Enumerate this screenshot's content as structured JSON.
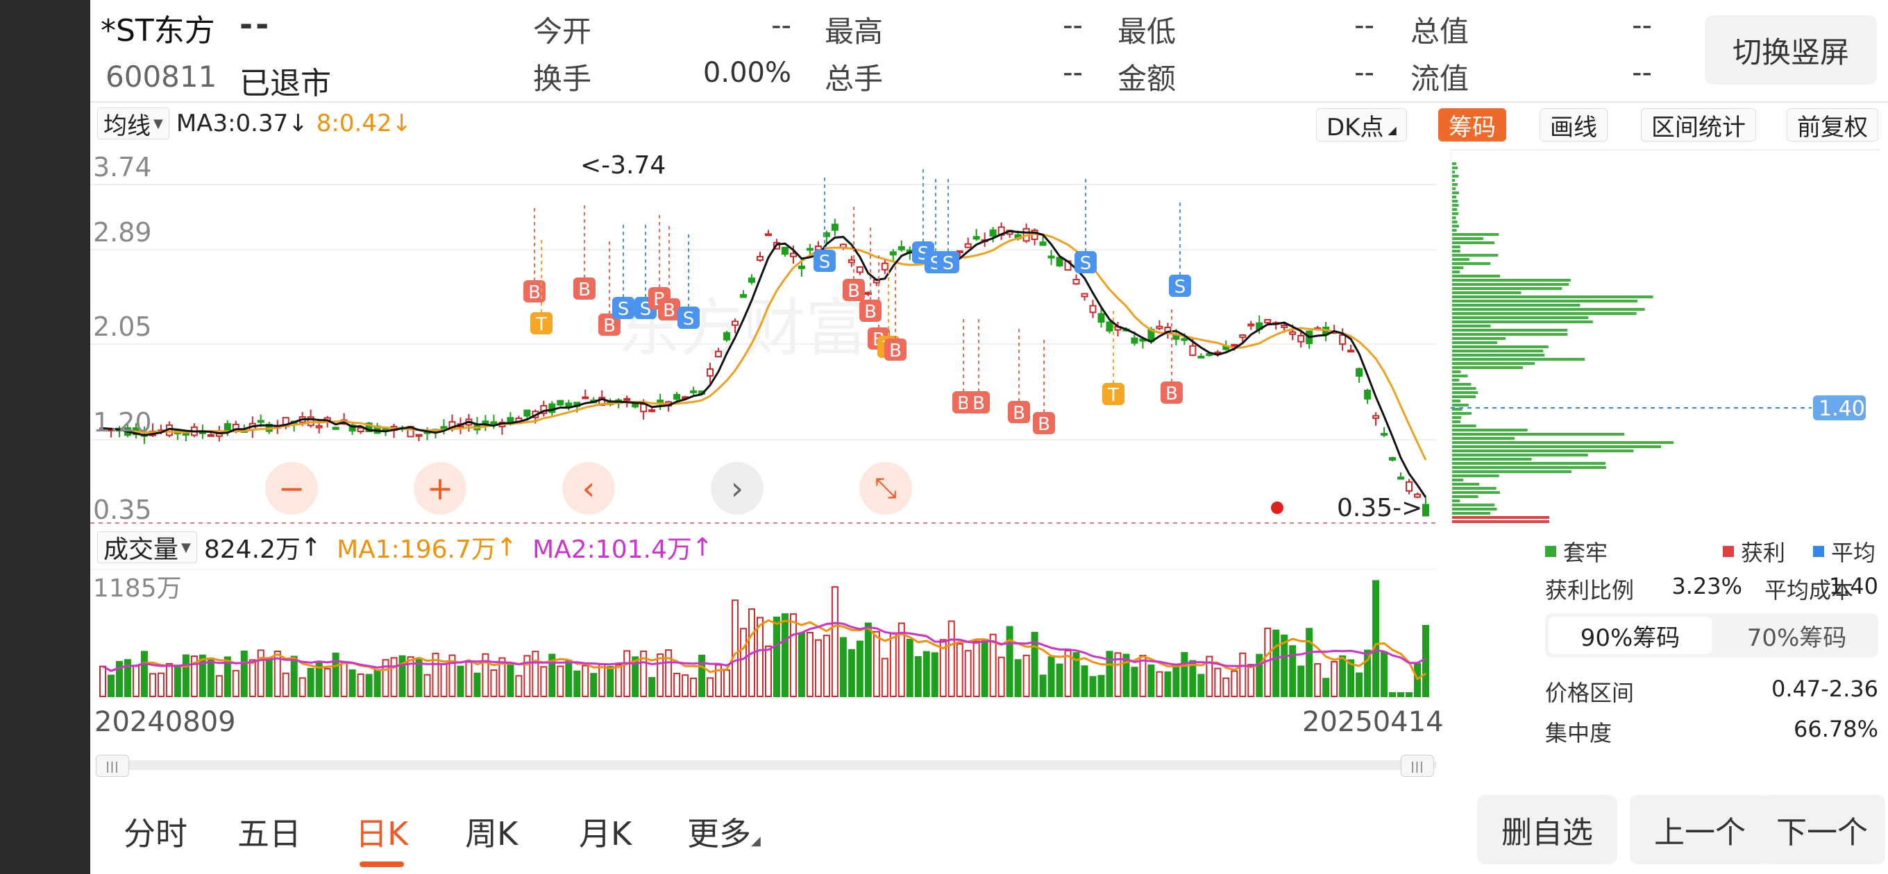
{
  "header": {
    "name": "*ST东方",
    "price": "--",
    "code": "600811",
    "status": "已退市",
    "switch_button": "切换竖屏",
    "quotes": [
      {
        "label": "今开",
        "value": "--"
      },
      {
        "label": "最高",
        "value": "--"
      },
      {
        "label": "最低",
        "value": "--"
      },
      {
        "label": "总值",
        "value": "--"
      },
      {
        "label": "换手",
        "value": "0.00%"
      },
      {
        "label": "总手",
        "value": "--"
      },
      {
        "label": "金额",
        "value": "--"
      },
      {
        "label": "流值",
        "value": "--"
      }
    ]
  },
  "ma_bar": {
    "selector": "均线",
    "ma3": "MA3:0.37",
    "ma3_arrow": "↓",
    "ma8": "8:0.42",
    "ma8_arrow": "↓",
    "colors": {
      "ma3": "#222222",
      "ma8": "#f0910a"
    }
  },
  "toolbar": {
    "dk": "DK点",
    "chips": "筹码",
    "draw": "画线",
    "range": "区间统计",
    "adjust": "前复权"
  },
  "price_chart": {
    "y_labels": [
      "3.74",
      "2.89",
      "2.05",
      "1.20",
      "0.35"
    ],
    "high_annotation": "<-3.74",
    "low_annotation": "0.35->",
    "avg_cost_tag": "1.40",
    "colors": {
      "up": "#cc2a2a",
      "down": "#1ea01e",
      "ma_slow": "#f0a020",
      "ma_fast": "#111111"
    },
    "signals": [
      {
        "letter": "B",
        "kind": "buy"
      },
      {
        "letter": "T",
        "kind": "t"
      },
      {
        "letter": "B",
        "kind": "buy"
      },
      {
        "letter": "B",
        "kind": "buy"
      },
      {
        "letter": "S",
        "kind": "sell"
      },
      {
        "letter": "S",
        "kind": "sell"
      },
      {
        "letter": "B",
        "kind": "buy"
      },
      {
        "letter": "B",
        "kind": "buy"
      },
      {
        "letter": "S",
        "kind": "sell"
      },
      {
        "letter": "S",
        "kind": "sell"
      },
      {
        "letter": "B",
        "kind": "buy"
      },
      {
        "letter": "B",
        "kind": "buy"
      },
      {
        "letter": "B",
        "kind": "buy"
      },
      {
        "letter": "T",
        "kind": "t"
      },
      {
        "letter": "B",
        "kind": "buy"
      },
      {
        "letter": "S",
        "kind": "sell"
      },
      {
        "letter": "S",
        "kind": "sell"
      },
      {
        "letter": "S",
        "kind": "sell"
      },
      {
        "letter": "B",
        "kind": "buy"
      },
      {
        "letter": "B",
        "kind": "buy"
      },
      {
        "letter": "B",
        "kind": "buy"
      },
      {
        "letter": "B",
        "kind": "buy"
      },
      {
        "letter": "S",
        "kind": "sell"
      },
      {
        "letter": "T",
        "kind": "t"
      },
      {
        "letter": "B",
        "kind": "buy"
      },
      {
        "letter": "S",
        "kind": "sell"
      }
    ]
  },
  "volume": {
    "selector": "成交量",
    "current": "824.2万",
    "current_arrow": "↑",
    "ma1": "MA1:196.7万",
    "ma1_arrow": "↑",
    "ma2": "MA2:101.4万",
    "ma2_arrow": "↑",
    "y_label": "1185万",
    "colors": {
      "ma1": "#f0910a",
      "ma2": "#cc33cc"
    }
  },
  "dates": {
    "start": "20240809",
    "end": "20250414"
  },
  "chips": {
    "legend": [
      {
        "label": "套牢",
        "color": "#33aa33"
      },
      {
        "label": "获利",
        "color": "#e04040"
      },
      {
        "label": "平均",
        "color": "#3388ee"
      }
    ],
    "profit_ratio_label": "获利比例",
    "profit_ratio": "3.23%",
    "avg_cost_label": "平均成本",
    "avg_cost": "1.40",
    "tab_90": "90%筹码",
    "tab_70": "70%筹码",
    "price_range_label": "价格区间",
    "price_range": "0.47-2.36",
    "concentration_label": "集中度",
    "concentration": "66.78%"
  },
  "nav": {
    "tabs": [
      "分时",
      "五日",
      "日K",
      "周K",
      "月K",
      "更多"
    ],
    "active": "日K"
  },
  "bottom_buttons": {
    "remove": "删自选",
    "prev": "上一个",
    "next": "下一个"
  },
  "zoom_controls": {
    "zoom_out": "−",
    "zoom_in": "+",
    "left": "‹",
    "right": "›",
    "compress": "⤡"
  }
}
